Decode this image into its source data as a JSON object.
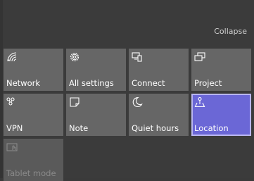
{
  "header": {
    "collapse_label": "Collapse"
  },
  "tiles": [
    {
      "label": "Network",
      "icon": "wifi-icon",
      "state": "normal"
    },
    {
      "label": "All settings",
      "icon": "gear-icon",
      "state": "normal"
    },
    {
      "label": "Connect",
      "icon": "connect-icon",
      "state": "normal"
    },
    {
      "label": "Project",
      "icon": "project-icon",
      "state": "normal"
    },
    {
      "label": "VPN",
      "icon": "vpn-icon",
      "state": "normal"
    },
    {
      "label": "Note",
      "icon": "note-icon",
      "state": "normal"
    },
    {
      "label": "Quiet hours",
      "icon": "moon-icon",
      "state": "normal"
    },
    {
      "label": "Location",
      "icon": "location-icon",
      "state": "active"
    },
    {
      "label": "Tablet mode",
      "icon": "tablet-mode-icon",
      "state": "disabled"
    }
  ],
  "colors": {
    "panel_bg": "#3b3b3b",
    "tile_bg": "#666666",
    "active_bg": "#6b67d6",
    "active_border": "#b9b6f0",
    "disabled_text": "#8a8a8a"
  }
}
